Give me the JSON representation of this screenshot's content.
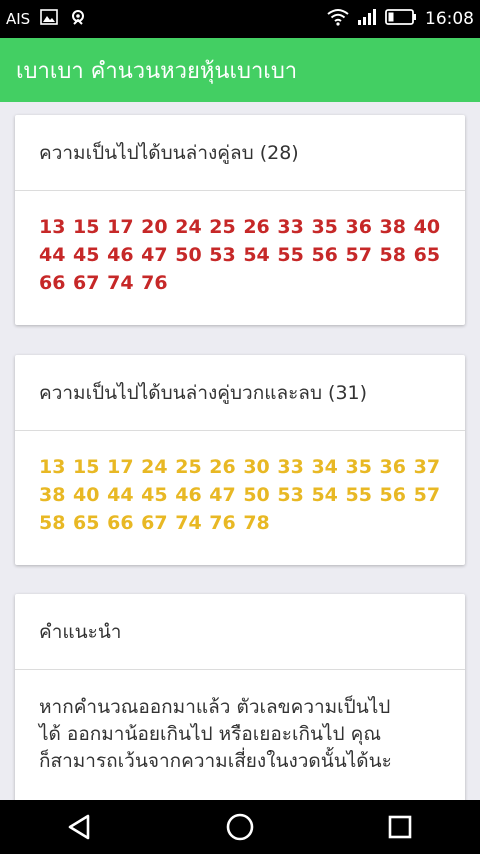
{
  "status_bar": {
    "carrier": "AIS",
    "time": "16:08"
  },
  "app_bar": {
    "title": "เบาเบา คำนวนหวยหุ้นเบาเบา"
  },
  "cards": [
    {
      "title": "ความเป็นไปได้บนล่างคู่ลบ (28)",
      "numbers_line1": "13 15 17 20 24 25 26 33 35 36 38 40",
      "numbers_line2": "44 45 46 47 50 53 54 55 56 57 58 65",
      "numbers_line3": "66 67 74 76",
      "color": "#c62828"
    },
    {
      "title": "ความเป็นไปได้บนล่างคู่บวกและลบ (31)",
      "numbers_line1": "13 15 17 24 25 26 30 33 34 35 36 37",
      "numbers_line2": "38 40 44 45 46 47 50 53 54 55 56 57",
      "numbers_line3": "58 65 66 67 74 76 78",
      "color": "#e8b824"
    },
    {
      "title": "คำแนะนำ",
      "line1": "หากคำนวณออกมาแล้ว ตัวเลขความเป็นไป",
      "line2": "ได้ ออกมาน้อยเกินไป หรือเยอะเกินไป คุณ",
      "line3": "ก็สามารถเว้นจากความเสี่ยงในงวดนั้นได้นะ"
    }
  ],
  "colors": {
    "app_bar": "#43cf63",
    "background": "#ececf2"
  }
}
